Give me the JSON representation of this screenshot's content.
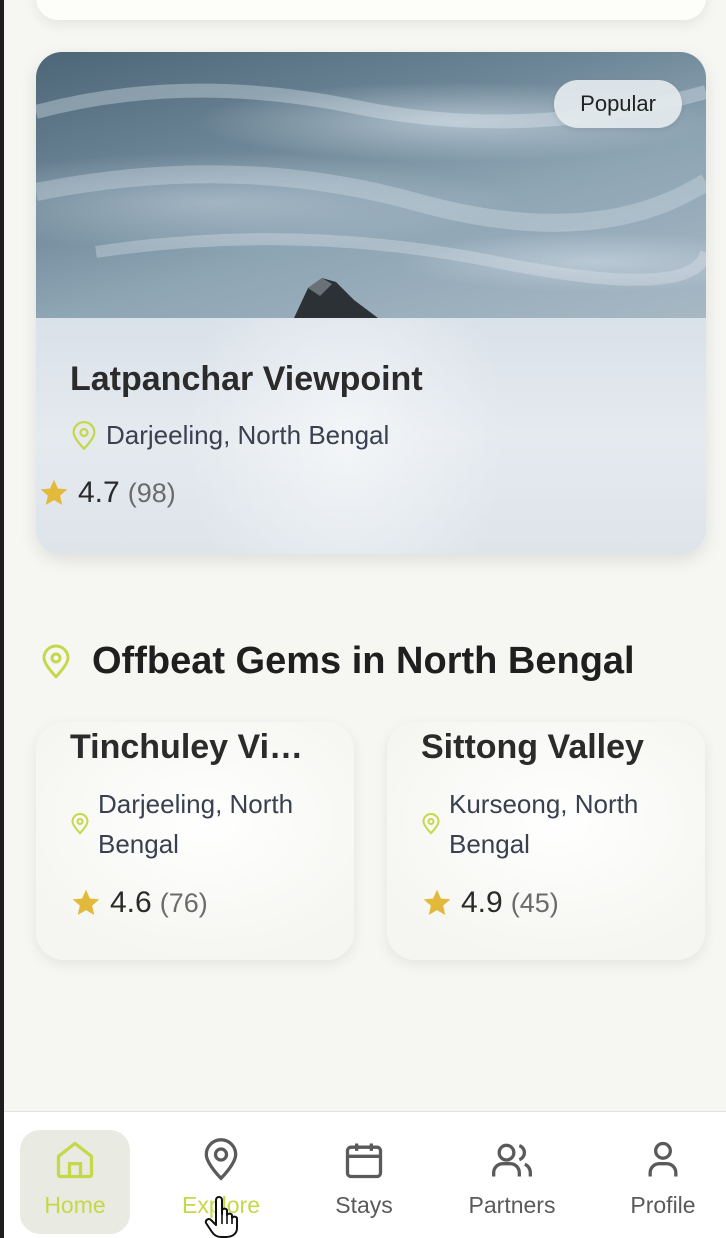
{
  "hero": {
    "badge": "Popular",
    "title": "Latpanchar Viewpoint",
    "location": "Darjeeling, North Bengal",
    "rating": "4.7",
    "reviews": "(98)"
  },
  "section": {
    "title": "Offbeat Gems in North Bengal"
  },
  "gems": [
    {
      "title": "Tinchuley Vi…",
      "location": "Darjeeling, North Bengal",
      "rating": "4.6",
      "reviews": "(76)"
    },
    {
      "title": "Sittong Valley",
      "location": "Kurseong, North Bengal",
      "rating": "4.9",
      "reviews": "(45)"
    }
  ],
  "nav": {
    "items": [
      {
        "label": "Home",
        "icon": "home-icon",
        "state": "active"
      },
      {
        "label": "Explore",
        "icon": "map-pin-icon",
        "state": "hover"
      },
      {
        "label": "Stays",
        "icon": "calendar-icon",
        "state": "default"
      },
      {
        "label": "Partners",
        "icon": "users-icon",
        "state": "default"
      },
      {
        "label": "Profile",
        "icon": "user-icon",
        "state": "default"
      }
    ]
  },
  "colors": {
    "accent": "#c5d84a",
    "star": "#e2b93b",
    "background": "#f6f6f2"
  }
}
